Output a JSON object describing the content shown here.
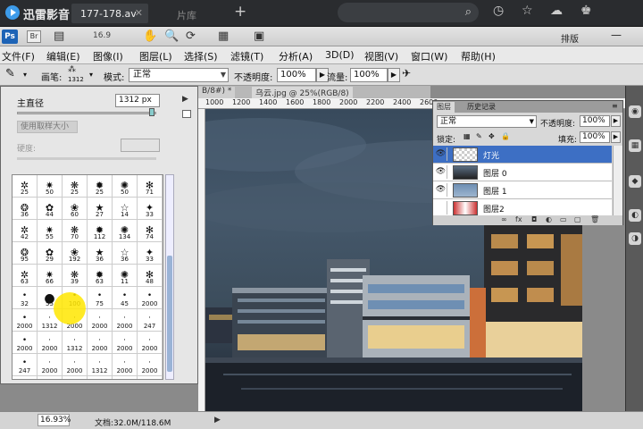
{
  "player": {
    "app_name": "迅雷影音",
    "tab_active": "177-178.av",
    "tab_library": "片库",
    "icons": [
      "search-icon",
      "history-icon",
      "star-icon",
      "cloud-icon",
      "skin-icon"
    ]
  },
  "appbar": {
    "logo": "Ps",
    "bridge": "Br",
    "zoom": "16.9",
    "workspace": "排版"
  },
  "menu": [
    "文件(F)",
    "编辑(E)",
    "图像(I)",
    "图层(L)",
    "选择(S)",
    "滤镜(T)",
    "分析(A)",
    "3D(D)",
    "视图(V)",
    "窗口(W)",
    "帮助(H)"
  ],
  "options": {
    "brush_label": "画笔:",
    "brush_size": "1312",
    "mode_label": "模式:",
    "mode_value": "正常",
    "opacity_label": "不透明度:",
    "opacity_value": "100%",
    "flow_label": "流量:",
    "flow_value": "100%"
  },
  "brush_picker": {
    "diameter_label": "主直径",
    "diameter_value": "1312 px",
    "use_sample_size": "使用取样大小",
    "hardness_label": "硬度:",
    "sizes": [
      "25",
      "50",
      "25",
      "25",
      "50",
      "71",
      "36",
      "44",
      "60",
      "27",
      "14",
      "33",
      "42",
      "55",
      "70",
      "112",
      "134",
      "74",
      "95",
      "29",
      "192",
      "36",
      "36",
      "33",
      "63",
      "66",
      "39",
      "63",
      "11",
      "48",
      "32",
      "55",
      "100",
      "75",
      "45",
      "2000",
      "2000",
      "1312",
      "2000",
      "2000",
      "2000",
      "247",
      "2000",
      "2000",
      "1312",
      "2000",
      "2000",
      "2000",
      "247",
      "2000",
      "2000",
      "1312",
      "2000",
      "2000",
      "2000",
      "2000",
      "2000",
      "2000",
      "2000",
      "2000",
      "247",
      "2000",
      "2000",
      "2000",
      "1312",
      "2000",
      "2200",
      "2000",
      "247",
      "28",
      "",
      ""
    ]
  },
  "documents": {
    "tab1": "B/8#) *",
    "tab2": "乌云.jpg @ 25%(RGB/8)",
    "ruler_ticks": [
      "1000",
      "1200",
      "1400",
      "1600",
      "1800",
      "2000",
      "2200",
      "2400",
      "2600",
      "2800",
      "3000",
      "3200",
      "3400",
      "3600"
    ]
  },
  "layers_panel": {
    "tab_layers": "图层",
    "tab_history": "历史记录",
    "blend_mode": "正常",
    "opacity_label": "不透明度:",
    "opacity_value": "100%",
    "lock_label": "锁定:",
    "fill_label": "填充:",
    "fill_value": "100%",
    "layers": [
      {
        "name": "灯光",
        "selected": true
      },
      {
        "name": "图层 0",
        "selected": false
      },
      {
        "name": "图层 1",
        "selected": false
      },
      {
        "name": "图层2",
        "selected": false
      }
    ]
  },
  "status": {
    "zoom": "16.93%",
    "doc_info": "文档:32.0M/118.6M"
  }
}
